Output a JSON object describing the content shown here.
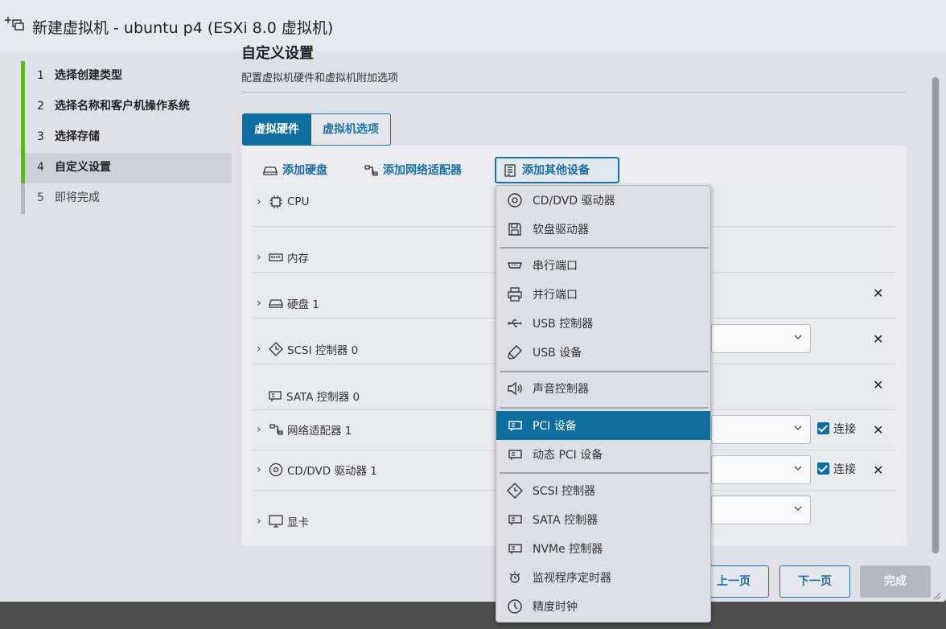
{
  "window": {
    "title": "新建虚拟机 - ubuntu p4 (ESXi 8.0 虚拟机)"
  },
  "steps": [
    {
      "num": "1",
      "label": "选择创建类型",
      "state": "done"
    },
    {
      "num": "2",
      "label": "选择名称和客户机操作系统",
      "state": "done"
    },
    {
      "num": "3",
      "label": "选择存储",
      "state": "done"
    },
    {
      "num": "4",
      "label": "自定义设置",
      "state": "current"
    },
    {
      "num": "5",
      "label": "即将完成",
      "state": "pending"
    }
  ],
  "section": {
    "title": "自定义设置",
    "subtitle": "配置虚拟机硬件和虚拟机附加选项"
  },
  "tabs": {
    "hardware": "虚拟硬件",
    "options": "虚拟机选项"
  },
  "toolbar": {
    "add_disk": "添加硬盘",
    "add_nic": "添加网络适配器",
    "add_other": "添加其他设备"
  },
  "hardware": {
    "cpu": "CPU",
    "memory": "内存",
    "disk": "硬盘 1",
    "scsi": "SCSI 控制器 0",
    "sata": "SATA 控制器 0",
    "nic": "网络适配器 1",
    "cdrom": "CD/DVD 驱动器 1",
    "video": "显卡",
    "connect_label": "连接"
  },
  "menu": {
    "items": [
      {
        "label": "CD/DVD 驱动器",
        "icon": "disc-icon"
      },
      {
        "label": "软盘驱动器",
        "icon": "floppy-icon"
      },
      {
        "label": "串行端口",
        "icon": "serial-port-icon"
      },
      {
        "label": "并行端口",
        "icon": "printer-icon"
      },
      {
        "label": "USB 控制器",
        "icon": "usb-icon"
      },
      {
        "label": "USB 设备",
        "icon": "usb-device-icon"
      },
      {
        "label": "声音控制器",
        "icon": "speaker-icon"
      },
      {
        "label": "PCI 设备",
        "icon": "pci-card-icon"
      },
      {
        "label": "动态 PCI 设备",
        "icon": "pci-card-icon"
      },
      {
        "label": "SCSI 控制器",
        "icon": "scsi-diamond-icon"
      },
      {
        "label": "SATA 控制器",
        "icon": "controller-card-icon"
      },
      {
        "label": "NVMe 控制器",
        "icon": "controller-card-icon"
      },
      {
        "label": "监视程序定时器",
        "icon": "watchdog-icon"
      },
      {
        "label": "精度时钟",
        "icon": "clock-icon"
      }
    ],
    "selected": "PCI 设备"
  },
  "footer": {
    "back": "上一页",
    "next": "下一页",
    "finish": "完成"
  },
  "colors": {
    "accent": "#0d6e9e",
    "step_done": "#5eb525",
    "step_pending": "#b5b6bb"
  }
}
